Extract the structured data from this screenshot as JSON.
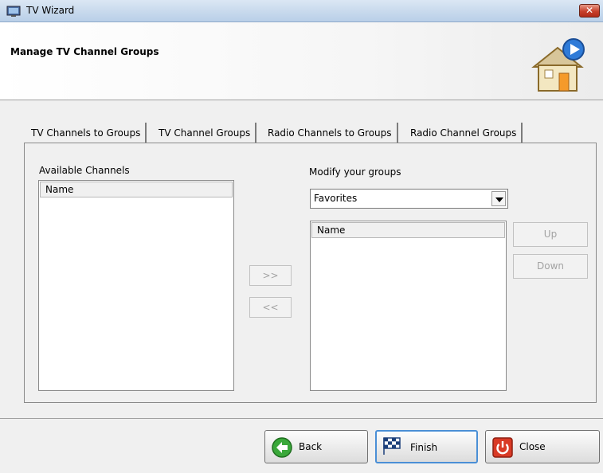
{
  "window": {
    "title": "TV Wizard"
  },
  "header": {
    "title": "Manage TV Channel Groups"
  },
  "tabs": [
    {
      "label": "TV Channels to Groups",
      "active": true
    },
    {
      "label": "TV Channel Groups",
      "active": false
    },
    {
      "label": "Radio Channels to Groups",
      "active": false
    },
    {
      "label": "Radio Channel Groups",
      "active": false
    }
  ],
  "available": {
    "label": "Available Channels",
    "column": "Name"
  },
  "groups": {
    "label": "Modify your groups",
    "selected": "Favorites",
    "column": "Name"
  },
  "buttons": {
    "add": ">>",
    "remove": "<<",
    "up": "Up",
    "down": "Down"
  },
  "footer": {
    "back": "Back",
    "finish": "Finish",
    "close": "Close"
  },
  "colors": {
    "accent": "#4a8fd6",
    "close_red": "#c7402b"
  }
}
